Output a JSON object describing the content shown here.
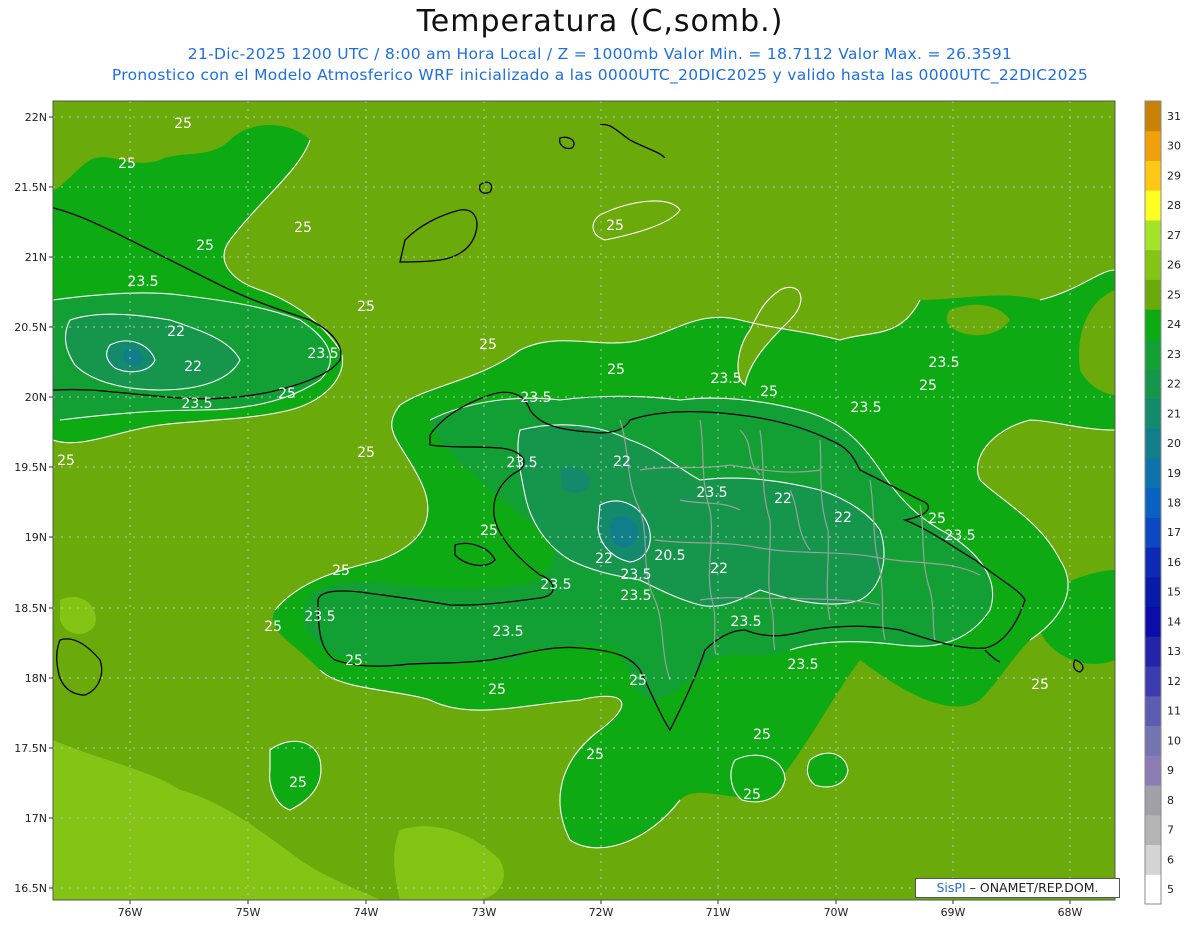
{
  "header": {
    "title": "Temperatura (C,somb.)",
    "line1": "21-Dic-2025  1200 UTC / 8:00 am Hora Local / Z = 1000mb   Valor Min. = 18.7112  Valor Max. = 26.3591",
    "line2": "Pronostico con el Modelo Atmosferico WRF inicializado a las 0000UTC_20DIC2025 y valido hasta las  0000UTC_22DIC2025"
  },
  "axes": {
    "lat_labels": [
      "22N",
      "21.5N",
      "21N",
      "20.5N",
      "20N",
      "19.5N",
      "19N",
      "18.5N",
      "18N",
      "17.5N",
      "17N",
      "16.5N"
    ],
    "lon_labels": [
      "76W",
      "75W",
      "74W",
      "73W",
      "72W",
      "71W",
      "70W",
      "69W",
      "68W"
    ]
  },
  "colorbar": {
    "levels": [
      "5",
      "6",
      "7",
      "8",
      "9",
      "10",
      "11",
      "12",
      "13",
      "14",
      "15",
      "16",
      "17",
      "18",
      "19",
      "20",
      "21",
      "22",
      "23",
      "24",
      "25",
      "26",
      "27",
      "28",
      "29",
      "30",
      "31"
    ],
    "colors": [
      "#ffffff",
      "#d4d4d4",
      "#b4b4b4",
      "#a0a0a8",
      "#8c7cb4",
      "#7474b0",
      "#5c5cb0",
      "#3c3cb0",
      "#2424a8",
      "#0c0ca8",
      "#0a1aa8",
      "#0c2ab4",
      "#0c48c0",
      "#0a62c0",
      "#0e72ac",
      "#127e8c",
      "#148a6c",
      "#16964c",
      "#12a034",
      "#0eaa14",
      "#6aaa0a",
      "#84c414",
      "#a4e428",
      "#ffff22",
      "#ffc814",
      "#f0a00a",
      "#c88206"
    ]
  },
  "contour_labels": [
    "25",
    "23.5",
    "22",
    "20.5"
  ],
  "credit": {
    "brand": "SisPI",
    "text": " – ONAMET/REP.DOM."
  },
  "colors": {
    "ocean": "#6aaa0a",
    "warm_ocean": "#84c414",
    "land_24": "#0eaa14",
    "land_23": "#12a034",
    "land_22": "#16964c",
    "land_21": "#148a6c",
    "land_20": "#127e8c",
    "subtitle": "#1e6fe0"
  }
}
